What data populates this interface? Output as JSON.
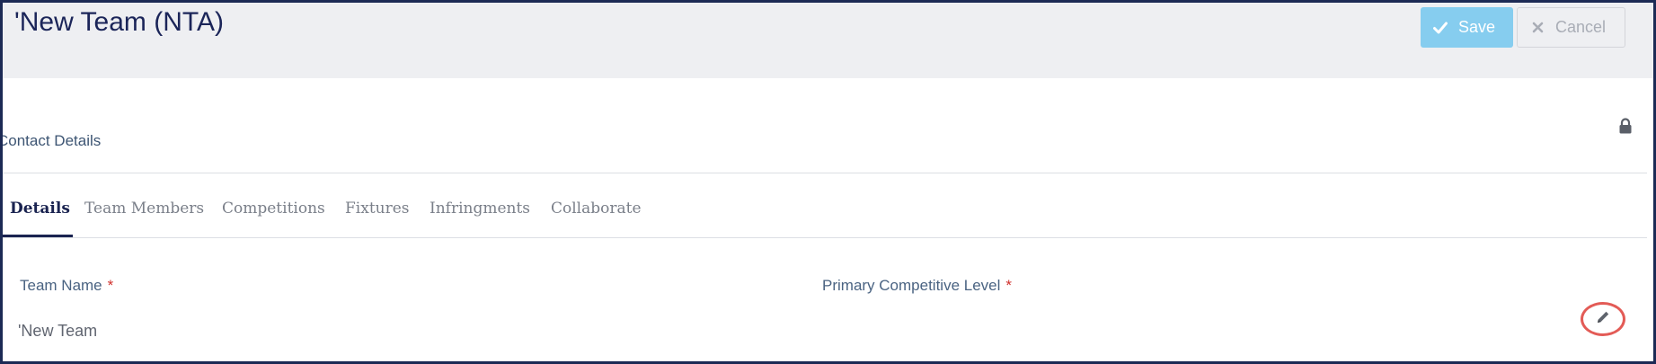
{
  "header": {
    "title": "'New Team (NTA)",
    "save_label": "Save",
    "cancel_label": "Cancel"
  },
  "section": {
    "title": "Contact Details",
    "lock_icon": "lock-icon"
  },
  "tabs": [
    {
      "label": "Details",
      "active": true
    },
    {
      "label": "Team Members",
      "active": false
    },
    {
      "label": "Competitions",
      "active": false
    },
    {
      "label": "Fixtures",
      "active": false
    },
    {
      "label": "Infringments",
      "active": false
    },
    {
      "label": "Collaborate",
      "active": false
    }
  ],
  "fields": {
    "team_name": {
      "label": "Team Name",
      "required": "*",
      "value": "'New Team"
    },
    "competitive_level": {
      "label": "Primary Competitive Level",
      "required": "*",
      "value": ""
    }
  },
  "colors": {
    "save_bg": "#86cdef",
    "title": "#1b2559",
    "required": "#d0312d",
    "highlight_ring": "#e35b56"
  }
}
